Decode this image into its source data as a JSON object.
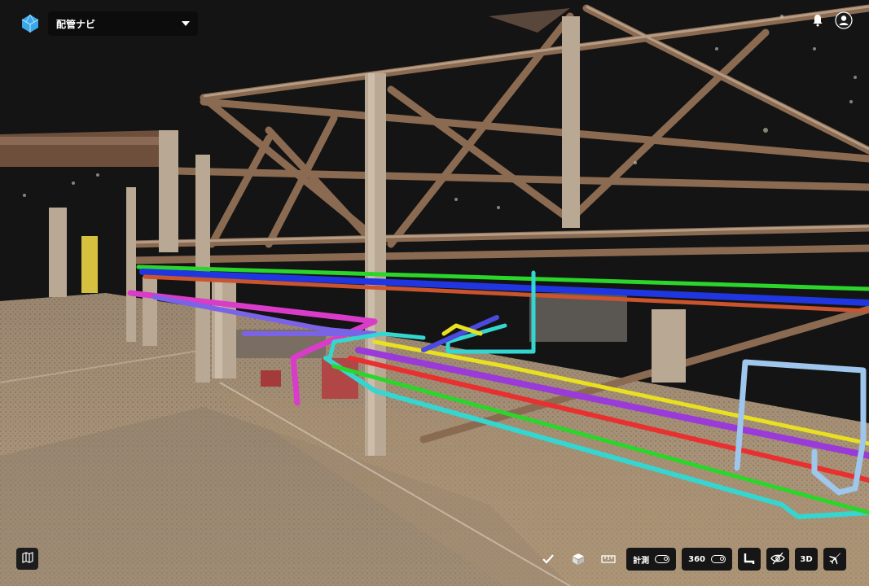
{
  "app": {
    "project_name": "配管ナビ"
  },
  "header": {
    "notification_icon": "bell-icon",
    "account_icon": "user-icon"
  },
  "toolbar": {
    "measure_label": "計測",
    "pano_label": "360",
    "view_3d_label": "3D",
    "icons": [
      "check-icon",
      "cube-icon",
      "ruler-icon",
      "pipe-route-icon",
      "eye-off-icon",
      "airplane-icon"
    ]
  },
  "colors": {
    "pipe_green": "#2bd62b",
    "pipe_blue": "#2036e0",
    "pipe_red": "#e83030",
    "pipe_yellow": "#e8e020",
    "pipe_magenta": "#d93cc8",
    "pipe_cyan": "#35d6d0",
    "pipe_purple": "#9a3ad8",
    "pipe_lightblue": "#9fc6ec"
  }
}
